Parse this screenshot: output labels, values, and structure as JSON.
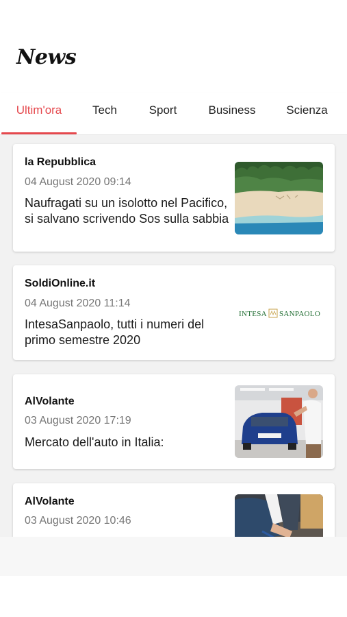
{
  "header": {
    "logo_text": "News"
  },
  "tabs": [
    {
      "label": "Ultim'ora",
      "active": true
    },
    {
      "label": "Tech"
    },
    {
      "label": "Sport"
    },
    {
      "label": "Business"
    },
    {
      "label": "Scienza"
    }
  ],
  "colors": {
    "accent": "#e5484d",
    "background": "#f2f2f2",
    "card": "#ffffff",
    "date_text": "#777777"
  },
  "articles": [
    {
      "source": "la Repubblica",
      "date": "04 August 2020 09:14",
      "title": "Naufragati su un isolotto nel Pacifico, si salvano scrivendo Sos sulla sabbia",
      "thumbnail": "island-beach-photo"
    },
    {
      "source": "SoldiOnline.it",
      "date": "04 August 2020 11:14",
      "title": "IntesaSanpaolo, tutti i numeri del primo semestre 2020",
      "thumbnail": "intesa-sanpaolo-logo",
      "logo_text": "INTESA SANPAOLO"
    },
    {
      "source": "AlVolante",
      "date": "03 August 2020 17:19",
      "title": "Mercato dell'auto in Italia:",
      "thumbnail": "car-showroom-photo"
    },
    {
      "source": "AlVolante",
      "date": "03 August 2020 10:46",
      "title": "",
      "thumbnail": "signing-document-photo"
    }
  ]
}
